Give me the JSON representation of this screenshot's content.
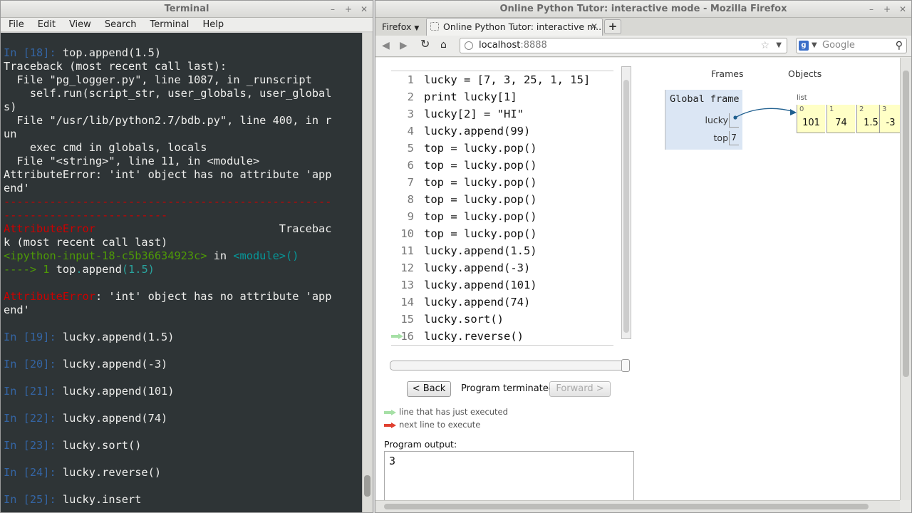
{
  "terminal": {
    "title": "Terminal",
    "menu": [
      "File",
      "Edit",
      "View",
      "Search",
      "Terminal",
      "Help"
    ],
    "lines": [
      [
        {
          "t": "In [",
          "c": "c-blue"
        },
        {
          "t": "18",
          "c": "c-blue"
        },
        {
          "t": "]: ",
          "c": "c-blue"
        },
        {
          "t": "top.append(1.5)",
          "c": ""
        }
      ],
      [
        {
          "t": "Traceback (most recent call last):",
          "c": ""
        }
      ],
      [
        {
          "t": "  File \"pg_logger.py\", line 1087, in _runscript",
          "c": ""
        }
      ],
      [
        {
          "t": "    self.run(script_str, user_globals, user_global",
          "c": ""
        }
      ],
      [
        {
          "t": "s)",
          "c": ""
        }
      ],
      [
        {
          "t": "  File \"/usr/lib/python2.7/bdb.py\", line 400, in r",
          "c": ""
        }
      ],
      [
        {
          "t": "un",
          "c": ""
        }
      ],
      [
        {
          "t": "    exec cmd in globals, locals",
          "c": ""
        }
      ],
      [
        {
          "t": "  File \"<string>\", line 11, in <module>",
          "c": ""
        }
      ],
      [
        {
          "t": "AttributeError: 'int' object has no attribute 'app",
          "c": ""
        }
      ],
      [
        {
          "t": "end'",
          "c": ""
        }
      ],
      [
        {
          "t": "--------------------------------------------------",
          "c": "c-red"
        }
      ],
      [
        {
          "t": "-------------------------",
          "c": "c-red"
        }
      ],
      [
        {
          "t": "AttributeError",
          "c": "c-red"
        },
        {
          "t": "                            Tracebac",
          "c": ""
        }
      ],
      [
        {
          "t": "k (most recent call last)",
          "c": ""
        }
      ],
      [
        {
          "t": "<ipython-input-18-c5b36634923c>",
          "c": "c-green"
        },
        {
          "t": " in ",
          "c": ""
        },
        {
          "t": "<module>()",
          "c": "c-cyan"
        }
      ],
      [
        {
          "t": "----> 1 ",
          "c": "c-green"
        },
        {
          "t": "top",
          "c": ""
        },
        {
          "t": ".",
          "c": "c-teal"
        },
        {
          "t": "append",
          "c": ""
        },
        {
          "t": "(1.5)",
          "c": "c-teal"
        }
      ],
      [
        {
          "t": "",
          "c": ""
        }
      ],
      [
        {
          "t": "AttributeError",
          "c": "c-red"
        },
        {
          "t": ": 'int' object has no attribute 'app",
          "c": ""
        }
      ],
      [
        {
          "t": "end'",
          "c": ""
        }
      ],
      [
        {
          "t": "",
          "c": ""
        }
      ],
      [
        {
          "t": "In [",
          "c": "c-blue"
        },
        {
          "t": "19",
          "c": "c-blue"
        },
        {
          "t": "]: ",
          "c": "c-blue"
        },
        {
          "t": "lucky.append(1.5)",
          "c": ""
        }
      ],
      [
        {
          "t": "",
          "c": ""
        }
      ],
      [
        {
          "t": "In [",
          "c": "c-blue"
        },
        {
          "t": "20",
          "c": "c-blue"
        },
        {
          "t": "]: ",
          "c": "c-blue"
        },
        {
          "t": "lucky.append(-3)",
          "c": ""
        }
      ],
      [
        {
          "t": "",
          "c": ""
        }
      ],
      [
        {
          "t": "In [",
          "c": "c-blue"
        },
        {
          "t": "21",
          "c": "c-blue"
        },
        {
          "t": "]: ",
          "c": "c-blue"
        },
        {
          "t": "lucky.append(101)",
          "c": ""
        }
      ],
      [
        {
          "t": "",
          "c": ""
        }
      ],
      [
        {
          "t": "In [",
          "c": "c-blue"
        },
        {
          "t": "22",
          "c": "c-blue"
        },
        {
          "t": "]: ",
          "c": "c-blue"
        },
        {
          "t": "lucky.append(74)",
          "c": ""
        }
      ],
      [
        {
          "t": "",
          "c": ""
        }
      ],
      [
        {
          "t": "In [",
          "c": "c-blue"
        },
        {
          "t": "23",
          "c": "c-blue"
        },
        {
          "t": "]: ",
          "c": "c-blue"
        },
        {
          "t": "lucky.sort()",
          "c": ""
        }
      ],
      [
        {
          "t": "",
          "c": ""
        }
      ],
      [
        {
          "t": "In [",
          "c": "c-blue"
        },
        {
          "t": "24",
          "c": "c-blue"
        },
        {
          "t": "]: ",
          "c": "c-blue"
        },
        {
          "t": "lucky.reverse()",
          "c": ""
        }
      ],
      [
        {
          "t": "",
          "c": ""
        }
      ],
      [
        {
          "t": "In [",
          "c": "c-blue"
        },
        {
          "t": "25",
          "c": "c-blue"
        },
        {
          "t": "]: ",
          "c": "c-blue"
        },
        {
          "t": "lucky.insert",
          "c": ""
        }
      ]
    ]
  },
  "firefox": {
    "title": "Online Python Tutor: interactive mode - Mozilla Firefox",
    "app_menu": "Firefox",
    "tab_title": "Online Python Tutor: interactive m...",
    "url_host": "localhost",
    "url_port": ":8888",
    "search_placeholder": "Google"
  },
  "tutor": {
    "code": [
      "lucky = [7, 3, 25, 1, 15]",
      "print lucky[1]",
      "lucky[2] = \"HI\"",
      "lucky.append(99)",
      "top = lucky.pop()",
      "top = lucky.pop()",
      "top = lucky.pop()",
      "top = lucky.pop()",
      "top = lucky.pop()",
      "top = lucky.pop()",
      "lucky.append(1.5)",
      "lucky.append(-3)",
      "lucky.append(101)",
      "lucky.append(74)",
      "lucky.sort()",
      "lucky.reverse()"
    ],
    "current_line": 16,
    "back_label": "< Back",
    "status": "Program terminated",
    "forward_label": "Forward >",
    "legend_executed": "line that has just executed",
    "legend_next": "next line to execute",
    "output_label": "Program output:",
    "output": "3",
    "frames_header": "Frames",
    "objects_header": "Objects",
    "global_frame": "Global frame",
    "vars": [
      {
        "name": "lucky",
        "value": ""
      },
      {
        "name": "top",
        "value": "7"
      }
    ],
    "list_label": "list",
    "list": [
      {
        "index": "0",
        "value": "101"
      },
      {
        "index": "1",
        "value": "74"
      },
      {
        "index": "2",
        "value": "1.5"
      },
      {
        "index": "3",
        "value": "-3"
      }
    ],
    "colors": {
      "arrow_executed": "#a6e0a6",
      "arrow_next": "#e04030",
      "frame_bg": "#dbe6f4",
      "list_bg": "#ffffc6",
      "pointer": "#1f5f8f"
    }
  }
}
